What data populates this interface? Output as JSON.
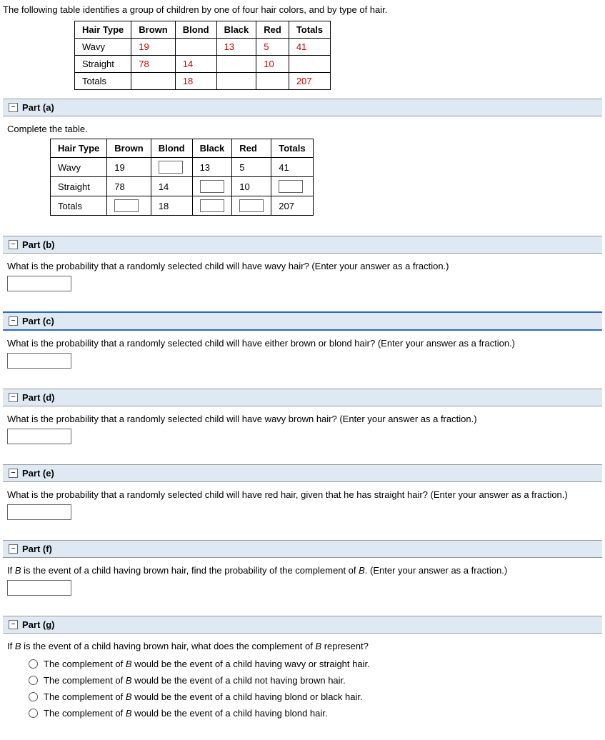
{
  "intro": "The following table identifies a group of children by one of four hair colors, and by type of hair.",
  "given_table": {
    "headers": [
      "Hair Type",
      "Brown",
      "Blond",
      "Black",
      "Red",
      "Totals"
    ],
    "rows": [
      [
        "Wavy",
        "19",
        "",
        "13",
        "5",
        "41"
      ],
      [
        "Straight",
        "78",
        "14",
        "",
        "10",
        ""
      ],
      [
        "Totals",
        "",
        "18",
        "",
        "",
        "207"
      ]
    ]
  },
  "toggle_symbol": "−",
  "parts": {
    "a": {
      "label": "Part (a)",
      "prompt": "Complete the table.",
      "table": {
        "headers": [
          "Hair Type",
          "Brown",
          "Blond",
          "Black",
          "Red",
          "Totals"
        ],
        "rows": [
          {
            "cells": [
              "Wavy",
              "19",
              "_input_",
              "13",
              "5",
              "41"
            ]
          },
          {
            "cells": [
              "Straight",
              "78",
              "14",
              "_input_",
              "10",
              "_input_"
            ]
          },
          {
            "cells": [
              "Totals",
              "_input_",
              "18",
              "_input_",
              "_input_",
              "207"
            ]
          }
        ]
      }
    },
    "b": {
      "label": "Part (b)",
      "prompt": "What is the probability that a randomly selected child will have wavy hair? (Enter your answer as a fraction.)"
    },
    "c": {
      "label": "Part (c)",
      "prompt": "What is the probability that a randomly selected child will have either brown or blond hair? (Enter your answer as a fraction.)"
    },
    "d": {
      "label": "Part (d)",
      "prompt": "What is the probability that a randomly selected child will have wavy brown hair? (Enter your answer as a fraction.)"
    },
    "e": {
      "label": "Part (e)",
      "prompt": "What is the probability that a randomly selected child will have red hair, given that he has straight hair? (Enter your answer as a fraction.)"
    },
    "f": {
      "label": "Part (f)",
      "prompt_pre": "If ",
      "prompt_var": "B",
      "prompt_mid": " is the event of a child having brown hair, find the probability of the complement of ",
      "prompt_post": ". (Enter your answer as a fraction.)"
    },
    "g": {
      "label": "Part (g)",
      "prompt_pre": "If ",
      "prompt_var": "B",
      "prompt_mid": " is the event of a child having brown hair, what does the complement of ",
      "prompt_post": " represent?",
      "options": [
        {
          "pre": "The complement of ",
          "var": "B",
          "post": " would be the event of a child having wavy or straight hair."
        },
        {
          "pre": "The complement of ",
          "var": "B",
          "post": " would be the event of a child not having brown hair."
        },
        {
          "pre": "The complement of ",
          "var": "B",
          "post": " would be the event of a child having blond or black hair."
        },
        {
          "pre": "The complement of ",
          "var": "B",
          "post": " would be the event of a child having blond hair."
        }
      ]
    }
  }
}
